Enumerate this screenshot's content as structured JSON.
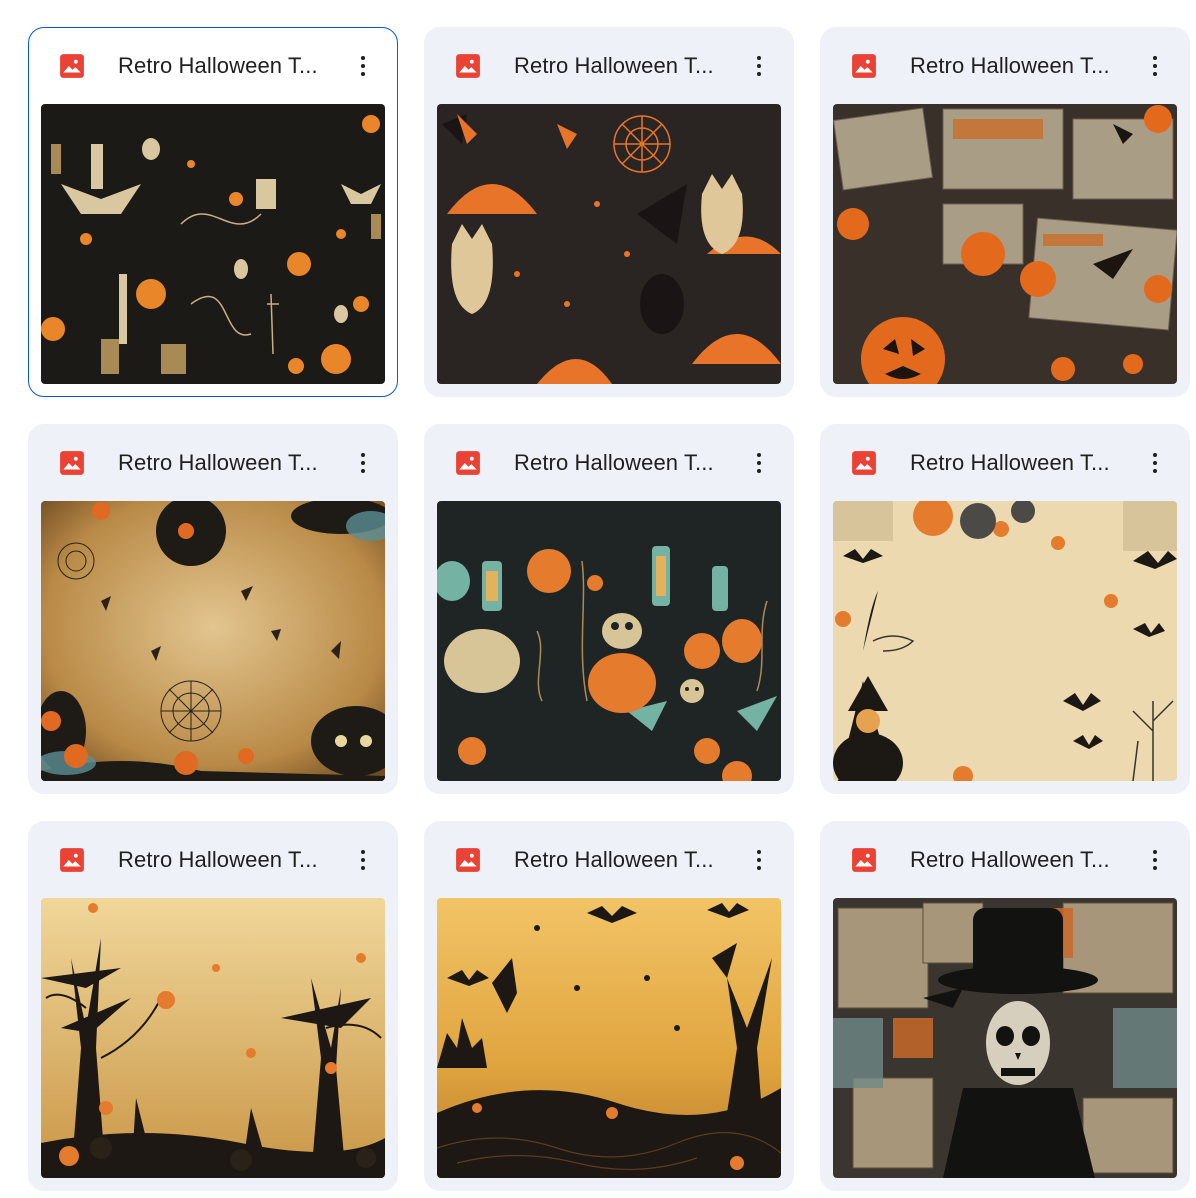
{
  "files": [
    {
      "title": "Retro Halloween T...",
      "selected": true
    },
    {
      "title": "Retro Halloween T...",
      "selected": false
    },
    {
      "title": "Retro Halloween T...",
      "selected": false
    },
    {
      "title": "Retro Halloween T...",
      "selected": false
    },
    {
      "title": "Retro Halloween T...",
      "selected": false
    },
    {
      "title": "Retro Halloween T...",
      "selected": false
    },
    {
      "title": "Retro Halloween T...",
      "selected": false
    },
    {
      "title": "Retro Halloween T...",
      "selected": false
    },
    {
      "title": "Retro Halloween T...",
      "selected": false
    }
  ],
  "icons": {
    "file_type": "image-file-icon",
    "menu": "more-vert-icon"
  },
  "colors": {
    "selected_border": "#0b57d0",
    "card_bg": "#eef2f8",
    "image_icon": "#ea4335"
  }
}
